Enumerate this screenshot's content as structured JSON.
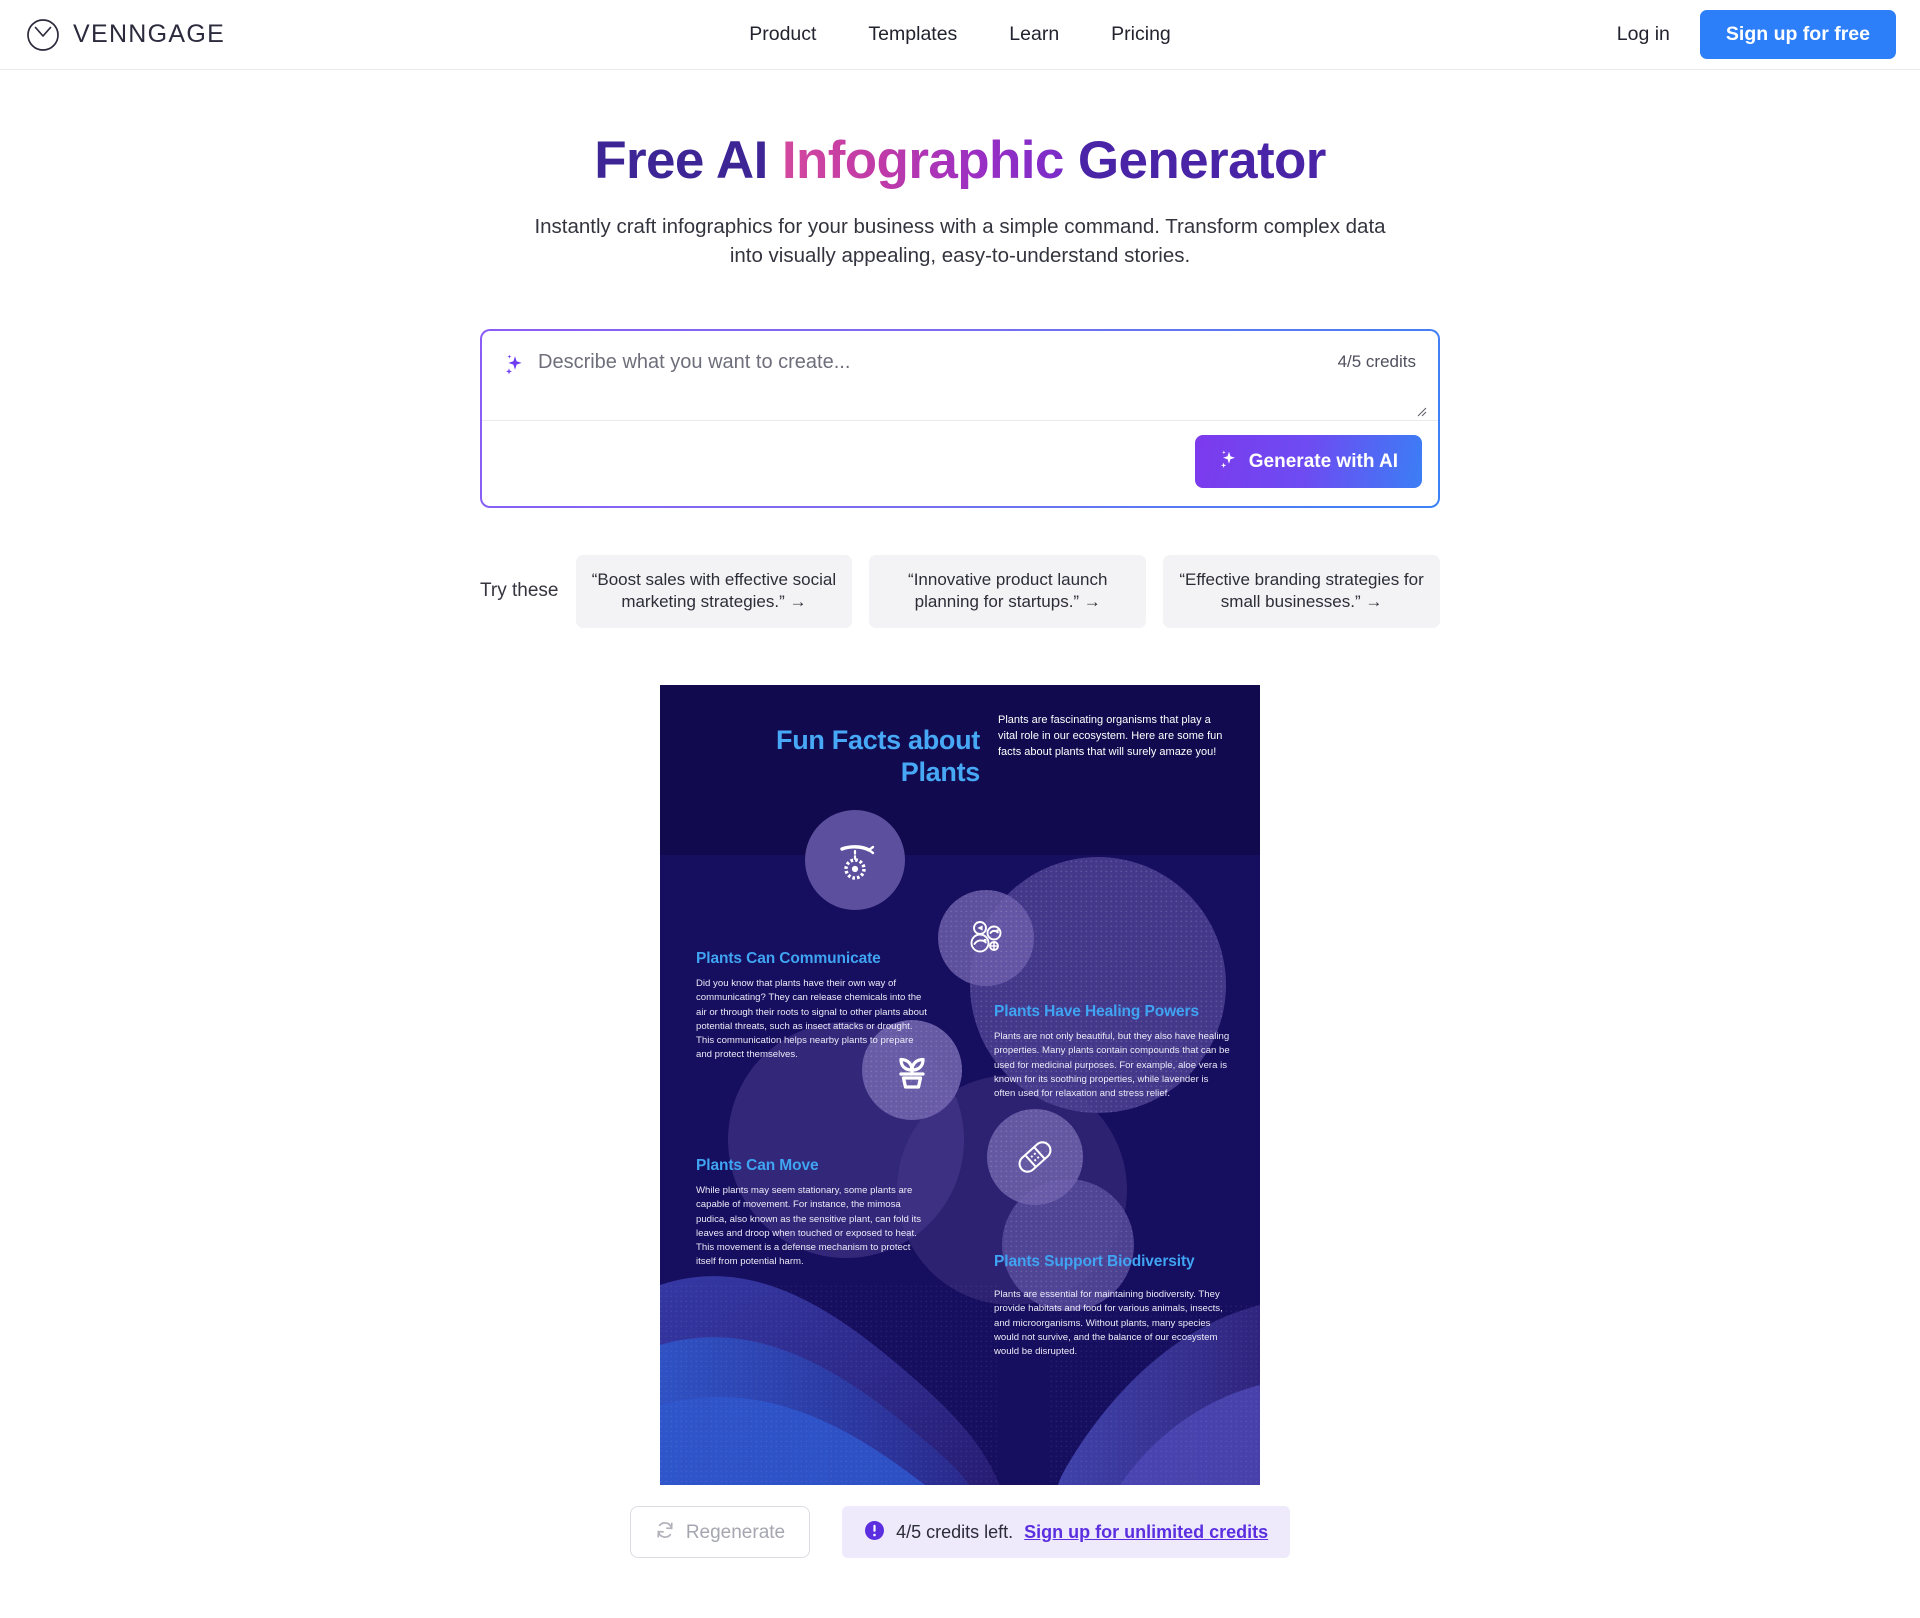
{
  "header": {
    "brand": "VENNGAGE",
    "brand_icon": "venngage-clock-logo",
    "nav": [
      {
        "label": "Product"
      },
      {
        "label": "Templates"
      },
      {
        "label": "Learn"
      },
      {
        "label": "Pricing"
      }
    ],
    "login_label": "Log in",
    "signup_label": "Sign up for free",
    "signup_color": "#2d7ff9"
  },
  "hero": {
    "title_part1": "Free AI ",
    "title_part2": "Infographic",
    "title_part3": " Generator",
    "subtitle": "Instantly craft infographics for your business with a simple command. Transform complex data into visually appealing, easy-to-understand stories.",
    "gradient_start": "#d3489e",
    "gradient_end": "#4a24a6"
  },
  "prompt": {
    "placeholder": "Describe what you want to create...",
    "value": "",
    "credits": "4/5 credits",
    "generate_label": "Generate with AI",
    "sparkle_icon": "sparkles-icon"
  },
  "suggestions": {
    "label": "Try these",
    "items": [
      {
        "text": "“Boost sales with effective social marketing strategies.” →"
      },
      {
        "text": "“Innovative product launch planning for startups.” →"
      },
      {
        "text": "“Effective branding strategies for small businesses.” →"
      }
    ]
  },
  "infographic": {
    "title": "Fun Facts about Plants",
    "title_line1": "Fun Facts about",
    "title_line2": "Plants",
    "intro": "Plants are fascinating organisms that play a vital role in our ecosystem. Here are some fun facts about plants that will surely amaze you!",
    "bg_color": "#160e5e",
    "heading_color": "#3fa4f2",
    "facts": [
      {
        "icon": "hanging-flower-branch-icon",
        "heading": "Plants Can Communicate",
        "body": "Did you know that plants have their own way of communicating? They can release chemicals into the air or through their roots to signal to other plants about potential threats, such as insect attacks or drought. This communication helps nearby plants to prepare and protect themselves."
      },
      {
        "icon": "herbs-leaves-icon",
        "heading": "Plants Have Healing Powers",
        "body": "Plants are not only beautiful, but they also have healing properties. Many plants contain compounds that can be used for medicinal purposes. For example, aloe vera is known for its soothing properties, while lavender is often used for relaxation and stress relief."
      },
      {
        "icon": "potted-plant-icon",
        "heading": "Plants Can Move",
        "body": "While plants may seem stationary, some plants are capable of movement. For instance, the mimosa pudica, also known as the sensitive plant, can fold its leaves and droop when touched or exposed to heat. This movement is a defense mechanism to protect itself from potential harm."
      },
      {
        "icon": "bandage-icon",
        "heading": "Plants Support Biodiversity",
        "body": "Plants are essential for maintaining biodiversity. They provide habitats and food for various animals, insects, and microorganisms. Without plants, many species would not survive, and the balance of our ecosystem would be disrupted."
      }
    ]
  },
  "actions": {
    "regenerate_label": "Regenerate",
    "regenerate_icon": "refresh-icon",
    "alert_icon": "exclamation-circle-icon",
    "credits_left": "4/5 credits left.",
    "signup_link": "Sign up for unlimited credits",
    "link_color": "#5b2fe0"
  }
}
